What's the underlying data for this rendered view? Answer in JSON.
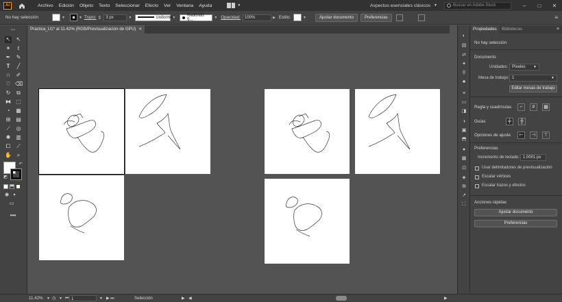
{
  "app": {
    "logo": "Ai"
  },
  "menu": [
    "Archivo",
    "Edición",
    "Objeto",
    "Texto",
    "Seleccionar",
    "Efecto",
    "Ver",
    "Ventana",
    "Ayuda"
  ],
  "workspace": "Aspectos esenciales clásicos",
  "search": {
    "placeholder": "Buscar en Adobe Stock"
  },
  "window_controls": [
    "–",
    "□",
    "✕"
  ],
  "control_bar": {
    "selection_status": "No hay selección",
    "stroke_label": "Trazo:",
    "stroke_value": "3 px",
    "stroke_profile": "Uniforme",
    "brush": "Redondo 5...",
    "opacity_label": "Opacidad:",
    "opacity_value": "100%",
    "style_label": "Estilo:",
    "fit_document_button": "Ajustar documento",
    "preferences_button": "Preferencias"
  },
  "document_tab": {
    "title": "Practica_U1* al 11.42% (RGB/Previsualización de GPU)",
    "close": "✕"
  },
  "properties_panel": {
    "tab_properties": "Propiedades",
    "tab_libraries": "Bibliotecas",
    "no_selection": "No hay selección",
    "document_section": "Documento",
    "units_label": "Unidades:",
    "units_value": "Píxeles",
    "artboard_label": "Mesa de trabajo:",
    "artboard_value": "1",
    "edit_artboards_button": "Editar mesas de trabajo",
    "rulers_grids": "Regla y cuadrículas",
    "guides": "Guías",
    "snap_options": "Opciones de ajuste",
    "preferences_section": "Preferencias",
    "keyboard_increment_label": "Incremento de teclado:",
    "keyboard_increment_value": "1.0001 px",
    "use_preview_bounds": "Usar delimitadores de previsualización",
    "scale_corners": "Escalar vértices",
    "scale_strokes": "Escalar trazos y efectos",
    "quick_actions": "Acciones rápidas",
    "fit_document_button": "Ajustar documento",
    "preferences_button": "Preferencias"
  },
  "status_bar": {
    "zoom": "11.42%",
    "artboard_number": "1",
    "tool": "Selección"
  },
  "colors": {
    "menu_bg": "#323232",
    "panel_bg": "#434343",
    "canvas_bg": "#535353",
    "accent": "#ff9a00"
  }
}
